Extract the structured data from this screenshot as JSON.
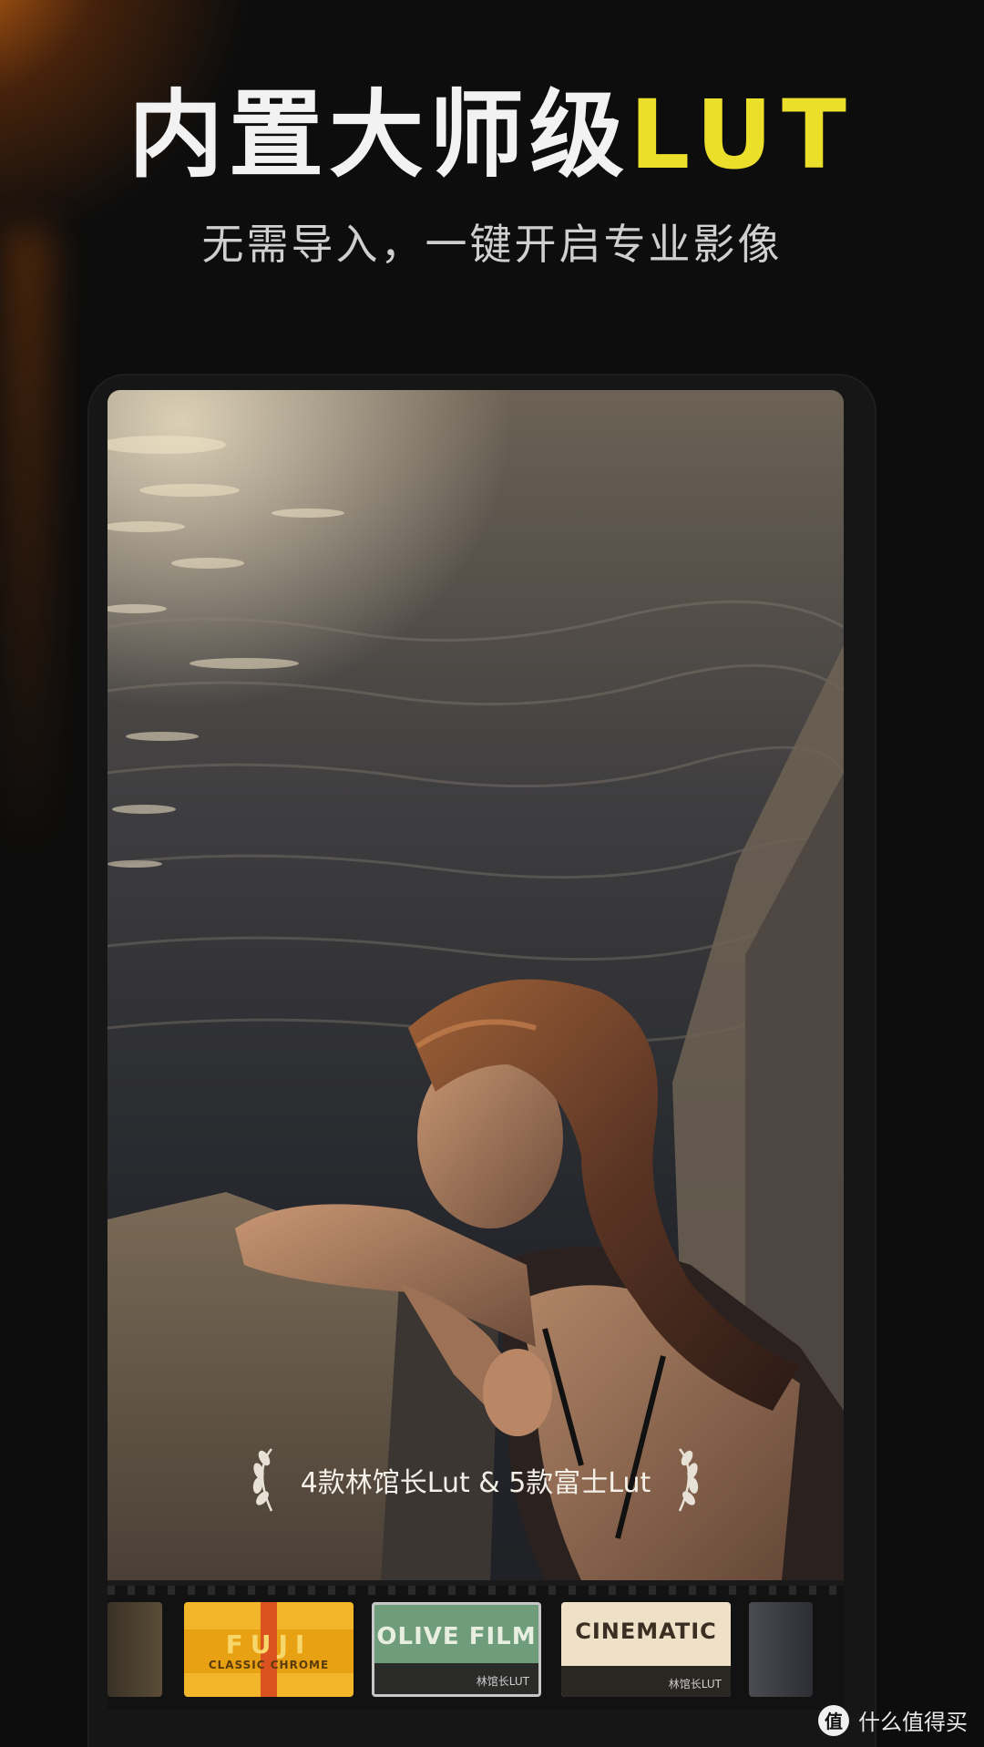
{
  "header": {
    "title_main": "内置大师级",
    "title_accent": "LUT",
    "subtitle": "无需导入，一键开启专业影像"
  },
  "badge": {
    "text": "4款林馆长Lut & 5款富士Lut"
  },
  "filters": [
    {
      "title": "FUJI",
      "subtitle": "CLASSIC CHROME"
    },
    {
      "title": "OLIVE FILM",
      "subtitle": "林馆长LUT"
    },
    {
      "title": "CINEMATIC",
      "subtitle": "林馆长LUT"
    }
  ],
  "watermark": {
    "logo": "值",
    "text": "什么值得买"
  },
  "colors": {
    "accent": "#ecdf2b",
    "fuji_card": "#f3b62a",
    "olive_card": "#6f9c7a",
    "cine_card": "#efe1c8"
  }
}
